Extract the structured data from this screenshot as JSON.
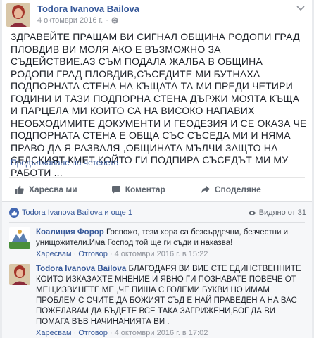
{
  "post": {
    "author": "Todora Ivanova Bailova",
    "date": "4 октомври 2016 г.",
    "text": "ЗДРАВЕЙТЕ ПРАЩАМ ВИ СИГНАЛ ОБЩИНА РОДОПИ ГРАД ПЛОВДИВ ВИ МОЛЯ АКО Е ВЪЗМОЖНО ЗА СЪДЕЙСТВИЕ.АЗ СЪМ ПОДАЛА ЖАЛБА В ОБЩИНА РОДОПИ ГРАД ПЛОВДИВ,СЪСЕДИТЕ МИ БУТНАХА ПОДПОРНАТА СТЕНА НА КЪЩАТА ТА МИ ПРЕДИ ЧЕТИРИ ГОДИНИ И ТАЗИ ПОДПОРНА СТЕНА ДЪРЖИ МОЯТА КЪЩА И ПАРЦЕЛА МИ КОИТО СА НА ВИСОКО НАПАВИХ НЕОБХОДИМИТЕ ДОКУМЕНТИ И ГЕОДЕЗИЯ И СЕ ОКАЗА ЧЕ ПОДПОРНАТА СТЕНА Е ОБЩА СЪС СЪСЕДА МИ И НЯМА ПРАВО ДА Я РАЗВАЛЯ ,ОБЩИНАТА МЪЛЧИ ЗАЩТО НА СЕЛСКИЯТ КМЕТ КОЙТО ГИ ПОДПИРА СЪСЕДЪТ МИ МУ РАБОТИ ...",
    "see_more": "Продължаване на четенето"
  },
  "actions": {
    "like": "Харесва ми",
    "comment": "Коментар",
    "share": "Споделяне"
  },
  "summary": {
    "likes": "Todora Ivanova Bailova и още 1",
    "seen": "Видяно от 31"
  },
  "comments": [
    {
      "name": "Коалиция Форор",
      "text": "Госпожо, тези хора са безсърдечни, безчестни и унищожители.Има Господ той ще ги съди и наказва!",
      "like": "Харесвам",
      "reply": "Отговор",
      "date": "4 октомври 2016 г. в 15:22"
    },
    {
      "name": "Todora Ivanova Bailova",
      "text": "БЛАГОДАРЯ ВИ ВИЕ СТЕ ЕДИНСТВЕННИТЕ КОИТО ИЗКАЗАХТЕ МНЕНИЕ И ЯВНО ГИ ПОЗНАВАТЕ ПОВЕЧЕ ОТ МЕН,ИЗВИНЕТЕ МЕ ,ЧЕ ПИША С ГОЛЕМИ БУКВИ НО ИМАМ ПРОБЛЕМ С ОЧИТЕ,ДА БОЖИЯТ СЪД Е НАЙ ПРАВЕДЕН А НА ВАС ПОЖЕЛАВАМ ДА БЪДЕТЕ ВСЕ ТАКА ЗАГРИЖЕНИ,БОГ ДА ВИ ПОМАГА ВЪВ НАЧИНАНИЯТА ВИ .",
      "like": "Харесвам",
      "reply": "Отговор",
      "date": "4 октомври 2016 г. в 17:02"
    }
  ],
  "icons": {
    "globe": "globe-icon",
    "chevron": "chevron-down-icon",
    "like": "thumbs-up-icon",
    "comment": "comment-icon",
    "share": "share-icon",
    "eye": "eye-icon"
  },
  "colors": {
    "link": "#365899",
    "muted": "#90949c",
    "bg": "#e9ebee"
  }
}
